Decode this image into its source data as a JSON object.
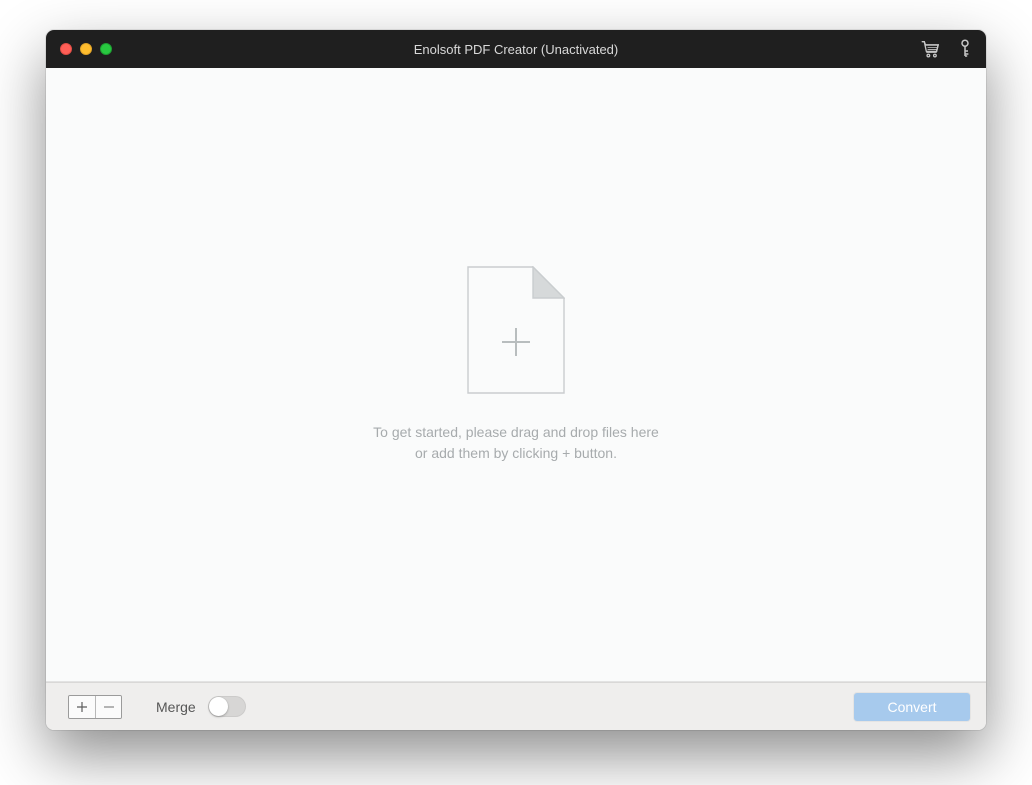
{
  "titlebar": {
    "title": "Enolsoft PDF Creator (Unactivated)"
  },
  "empty_state": {
    "line1": "To get started, please drag and drop files here",
    "line2": "or add them by clicking + button."
  },
  "footer": {
    "plus_label": "+",
    "minus_label": "−",
    "merge_label": "Merge",
    "merge_on": false,
    "convert_label": "Convert"
  },
  "colors": {
    "accent": "#a7caed",
    "titlebar_bg": "#1f1f1f"
  }
}
